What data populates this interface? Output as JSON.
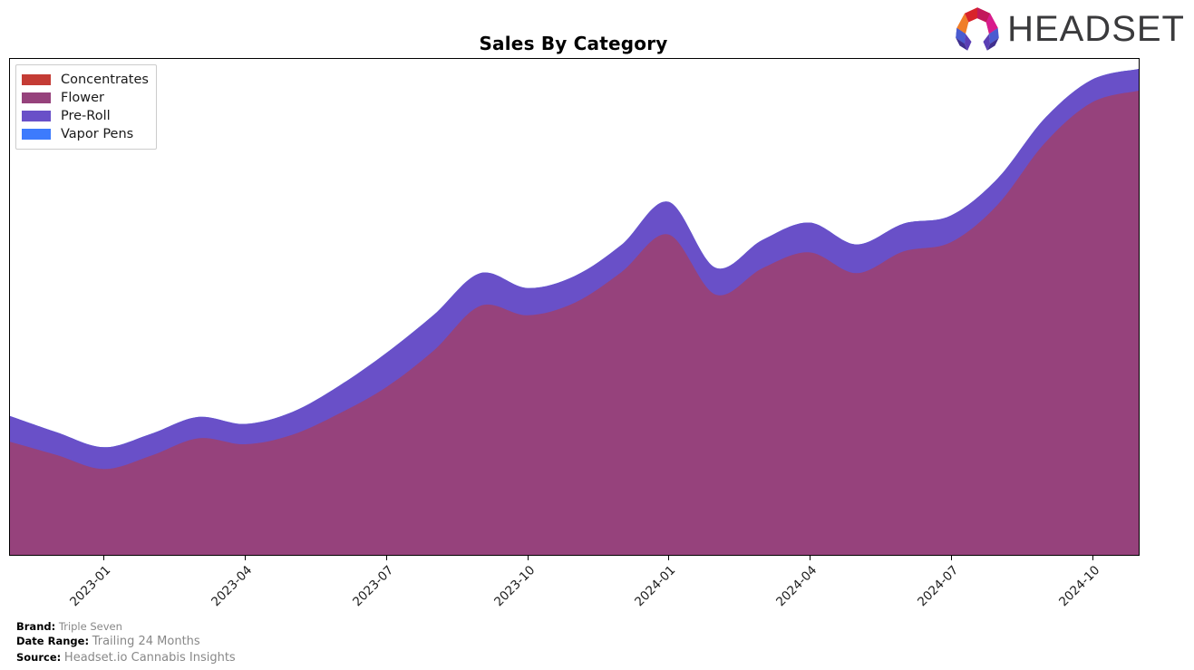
{
  "header": {
    "title": "Sales By Category",
    "logo_text": "HEADSET",
    "logo_icon": "headset-hexagon-logo"
  },
  "legend": {
    "position": "upper-left",
    "items": [
      {
        "label": "Concentrates",
        "color": "#c43c35"
      },
      {
        "label": "Flower",
        "color": "#96427c"
      },
      {
        "label": "Pre-Roll",
        "color": "#6950c8"
      },
      {
        "label": "Vapor Pens",
        "color": "#3d7bfd"
      }
    ]
  },
  "footer": {
    "brand_key": "Brand:",
    "brand_value": "Triple Seven",
    "date_range_key": "Date Range:",
    "date_range_value": "Trailing 24 Months",
    "source_key": "Source:",
    "source_value": "Headset.io Cannabis Insights"
  },
  "chart_data": {
    "type": "area",
    "stacked": true,
    "title": "Sales By Category",
    "xlabel": "",
    "ylabel": "",
    "grid": false,
    "legend_position": "upper-left",
    "x": [
      "2022-11",
      "2022-12",
      "2023-01",
      "2023-02",
      "2023-03",
      "2023-04",
      "2023-05",
      "2023-06",
      "2023-07",
      "2023-08",
      "2023-09",
      "2023-10",
      "2023-11",
      "2023-12",
      "2024-01",
      "2024-02",
      "2024-03",
      "2024-04",
      "2024-05",
      "2024-06",
      "2024-07",
      "2024-08",
      "2024-09",
      "2024-10",
      "2024-11"
    ],
    "tick_labels": [
      "2023-01",
      "2023-04",
      "2023-07",
      "2023-10",
      "2024-01",
      "2024-04",
      "2024-07",
      "2024-10"
    ],
    "tick_index": [
      2,
      5,
      8,
      11,
      14,
      17,
      20,
      23
    ],
    "ylim": [
      0,
      100
    ],
    "series": [
      {
        "name": "Concentrates",
        "color": "#c43c35",
        "values": [
          0,
          0,
          0,
          0,
          0,
          0,
          0,
          0,
          0,
          0,
          0,
          0,
          0,
          0,
          0,
          0,
          0,
          0,
          0,
          0,
          0,
          0,
          0,
          0,
          0
        ]
      },
      {
        "name": "Flower",
        "color": "#96427c",
        "values": [
          22.8,
          20.1,
          17.3,
          20.0,
          23.5,
          22.3,
          24.2,
          28.5,
          33.8,
          41.1,
          50.2,
          48.3,
          50.8,
          57.0,
          64.6,
          52.5,
          57.8,
          61.0,
          56.8,
          61.2,
          63.0,
          70.6,
          83.0,
          91.2,
          93.6
        ]
      },
      {
        "name": "Pre-Roll",
        "color": "#6950c8",
        "values": [
          5.2,
          4.6,
          4.4,
          4.4,
          4.3,
          4.1,
          4.6,
          5.6,
          6.9,
          7.2,
          6.6,
          5.5,
          5.4,
          5.5,
          6.6,
          5.4,
          5.7,
          6.0,
          5.8,
          5.6,
          5.4,
          5.3,
          5.0,
          4.6,
          4.4
        ]
      },
      {
        "name": "Vapor Pens",
        "color": "#3d7bfd",
        "values": [
          0,
          0,
          0,
          0,
          0,
          0,
          0,
          0,
          0,
          0,
          0,
          0,
          0,
          0,
          0,
          0,
          0,
          0,
          0,
          0,
          0,
          0,
          0,
          0,
          0
        ]
      }
    ]
  }
}
